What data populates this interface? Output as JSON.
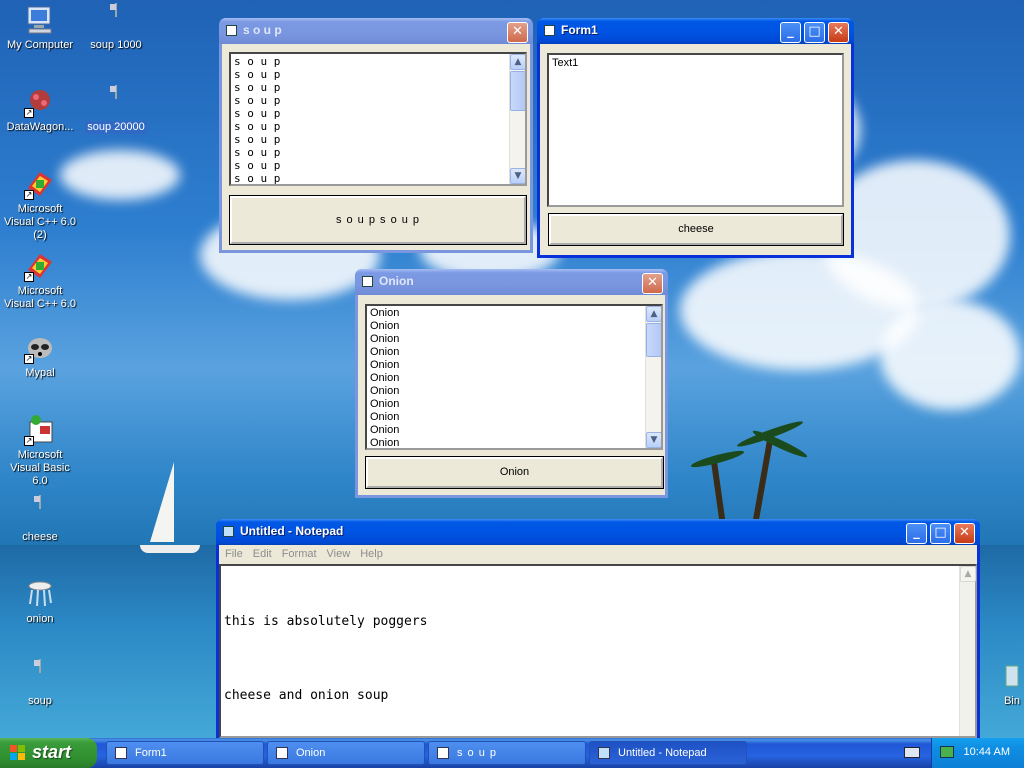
{
  "desktop": {
    "icons": [
      {
        "label": "My Computer",
        "icon": "computer-icon"
      },
      {
        "label": "soup 1000",
        "icon": "file-icon"
      },
      {
        "label": "DataWagon...",
        "icon": "datawagon-icon"
      },
      {
        "label": "soup 20000",
        "icon": "file-icon"
      },
      {
        "label": "Microsoft Visual C++ 6.0 (2)",
        "icon": "visual-cpp-icon"
      },
      {
        "label": "Microsoft Visual C++ 6.0",
        "icon": "visual-cpp-icon"
      },
      {
        "label": "Mypal",
        "icon": "mypal-browser-icon"
      },
      {
        "label": "Microsoft Visual Basic 6.0",
        "icon": "visual-basic-icon"
      },
      {
        "label": "cheese",
        "icon": "file-icon"
      },
      {
        "label": "onion",
        "icon": "onion-app-icon"
      },
      {
        "label": "soup",
        "icon": "file-icon"
      },
      {
        "label": "Bin",
        "icon": "recycle-bin-icon"
      }
    ]
  },
  "soup_window": {
    "title": "s o u p",
    "list_items": [
      "s o u p",
      "s o u p",
      "s o u p",
      "s o u p",
      "s o u p",
      "s o u p",
      "s o u p",
      "s o u p",
      "s o u p",
      "s o u p"
    ],
    "button_label": "s o u p s o u p"
  },
  "form1_window": {
    "title": "Form1",
    "text_value": "Text1",
    "button_label": "cheese"
  },
  "onion_window": {
    "title": "Onion",
    "list_items": [
      "Onion",
      "Onion",
      "Onion",
      "Onion",
      "Onion",
      "Onion",
      "Onion",
      "Onion",
      "Onion",
      "Onion",
      "Onion"
    ],
    "button_label": "Onion"
  },
  "notepad_window": {
    "title": "Untitled - Notepad",
    "menu": [
      "File",
      "Edit",
      "Format",
      "View",
      "Help"
    ],
    "lines": [
      "this is absolutely poggers",
      "cheese and onion soup"
    ]
  },
  "taskbar": {
    "start_label": "start",
    "tasks": [
      {
        "label": "Form1",
        "icon": "form-window-icon"
      },
      {
        "label": "Onion",
        "icon": "onion-app-icon"
      },
      {
        "label": "s o u p",
        "icon": "form-window-icon"
      },
      {
        "label": "Untitled - Notepad",
        "icon": "notepad-icon"
      }
    ],
    "clock": "10:44 AM"
  },
  "colors": {
    "active_title": "#0054e3",
    "inactive_title": "#7a96df",
    "start_green": "#3a9c3a",
    "window_face": "#ece9d8"
  }
}
